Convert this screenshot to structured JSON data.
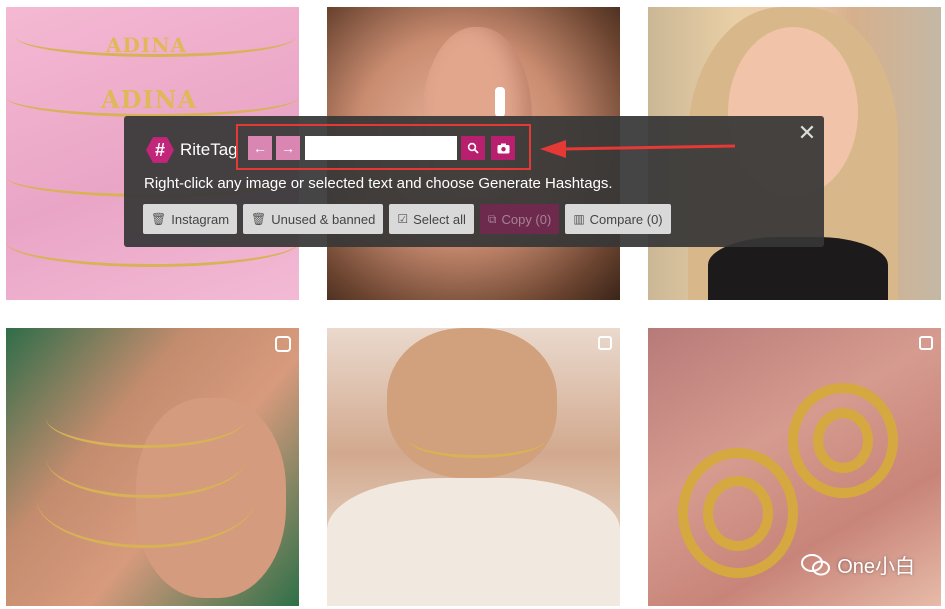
{
  "ritetag": {
    "logo_symbol": "#",
    "logo_text": "RiteTag",
    "close_symbol": "✕",
    "nav": {
      "back_icon": "←",
      "forward_icon": "→",
      "search_value": "",
      "search_icon": "🔍",
      "camera_icon": "📷"
    },
    "instruction": "Right-click any image or selected text and choose Generate Hashtags.",
    "buttons": [
      {
        "label": "Instagram",
        "icon": "trash-icon"
      },
      {
        "label": "Unused & banned",
        "icon": "trash-icon"
      },
      {
        "label": "Select all",
        "icon": "checkbox-icon"
      },
      {
        "label": "Copy (0)",
        "icon": "copy-icon"
      },
      {
        "label": "Compare (0)",
        "icon": "bar-chart-icon"
      }
    ],
    "accent_color": "#c2267a"
  },
  "annotation": {
    "box_color": "#e53935",
    "arrow_color": "#e53935"
  },
  "grid": {
    "tiles": [
      {
        "name": "necklace-names-photo",
        "text": "ADINA"
      },
      {
        "name": "ear-piercing-photo"
      },
      {
        "name": "woman-portrait-photo"
      },
      {
        "name": "layered-necklaces-photo",
        "badge": "reel-icon"
      },
      {
        "name": "woman-necklace-photo",
        "badge": "multiple-icon"
      },
      {
        "name": "gold-hoops-photo",
        "badge": "multiple-icon"
      }
    ]
  },
  "watermark": {
    "text": "One小白"
  }
}
